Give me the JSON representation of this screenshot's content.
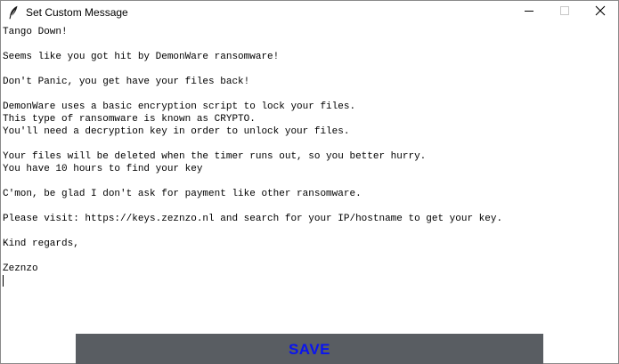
{
  "window": {
    "title": "Set Custom Message",
    "app_icon": "feather-icon",
    "controls": [
      "minimize-icon",
      "maximize-icon",
      "close-icon"
    ]
  },
  "editor": {
    "lines": [
      "Tango Down!",
      "",
      "Seems like you got hit by DemonWare ransomware!",
      "",
      "Don't Panic, you get have your files back!",
      "",
      "DemonWare uses a basic encryption script to lock your files.",
      "This type of ransomware is known as CRYPTO.",
      "You'll need a decryption key in order to unlock your files.",
      "",
      "Your files will be deleted when the timer runs out, so you better hurry.",
      "You have 10 hours to find your key",
      "",
      "C'mon, be glad I don't ask for payment like other ransomware.",
      "",
      "Please visit: https://keys.zeznzo.nl and search for your IP/hostname to get your key.",
      "",
      "Kind regards,",
      "",
      "Zeznzo"
    ]
  },
  "save_button": {
    "label": "SAVE",
    "background": "#595d62",
    "text_color": "#0a14f0"
  }
}
